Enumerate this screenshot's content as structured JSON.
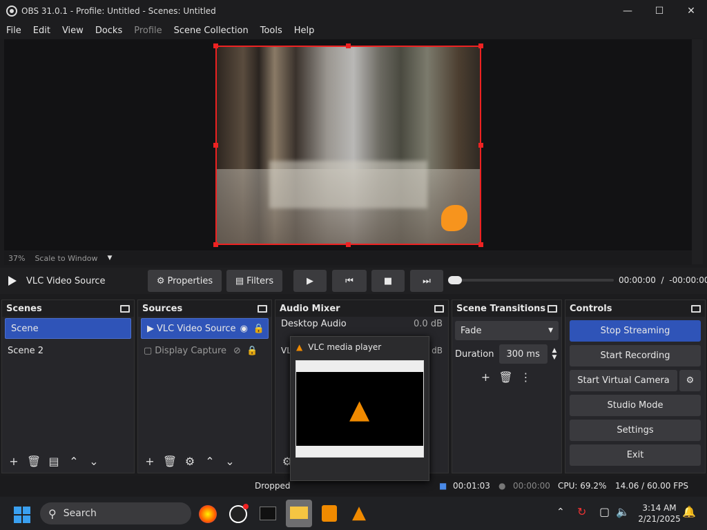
{
  "window": {
    "title": "OBS 31.0.1 - Profile: Untitled - Scenes: Untitled"
  },
  "menu": [
    "File",
    "Edit",
    "View",
    "Docks",
    "Profile",
    "Scene Collection",
    "Tools",
    "Help"
  ],
  "zoom": {
    "percent": "37%",
    "mode": "Scale to Window"
  },
  "source_bar": {
    "name": "VLC Video Source",
    "properties": "Properties",
    "filters": "Filters",
    "time_current": "00:00:00",
    "time_sep": "/",
    "time_remaining": "-00:00:00",
    "progress": 0
  },
  "scenes": {
    "title": "Scenes",
    "items": [
      "Scene",
      "Scene 2"
    ]
  },
  "sources": {
    "title": "Sources",
    "items": [
      "VLC Video Source",
      "Display Capture"
    ]
  },
  "mixer": {
    "title": "Audio Mixer",
    "desktop": "Desktop Audio",
    "desktop_db": "0.0 dB",
    "vlc_prefix": "VL",
    "vlc_db": "dB"
  },
  "transitions": {
    "title": "Scene Transitions",
    "selected": "Fade",
    "duration_label": "Duration",
    "duration": "300 ms"
  },
  "controls": {
    "title": "Controls",
    "stop_streaming": "Stop Streaming",
    "start_recording": "Start Recording",
    "start_virtual_camera": "Start Virtual Camera",
    "studio_mode": "Studio Mode",
    "settings": "Settings",
    "exit": "Exit"
  },
  "status": {
    "dropped": "Dropped",
    "stream_time": "00:01:03",
    "rec_time": "00:00:00",
    "cpu": "CPU: 69.2%",
    "fps": "14.06 / 60.00 FPS"
  },
  "vlc_popup": {
    "title": "VLC media player"
  },
  "taskbar": {
    "search": "Search",
    "time": "3:14 AM",
    "date": "2/21/2025"
  },
  "colors": {
    "accent": "#2f54b8",
    "selection_red": "#e22222"
  }
}
